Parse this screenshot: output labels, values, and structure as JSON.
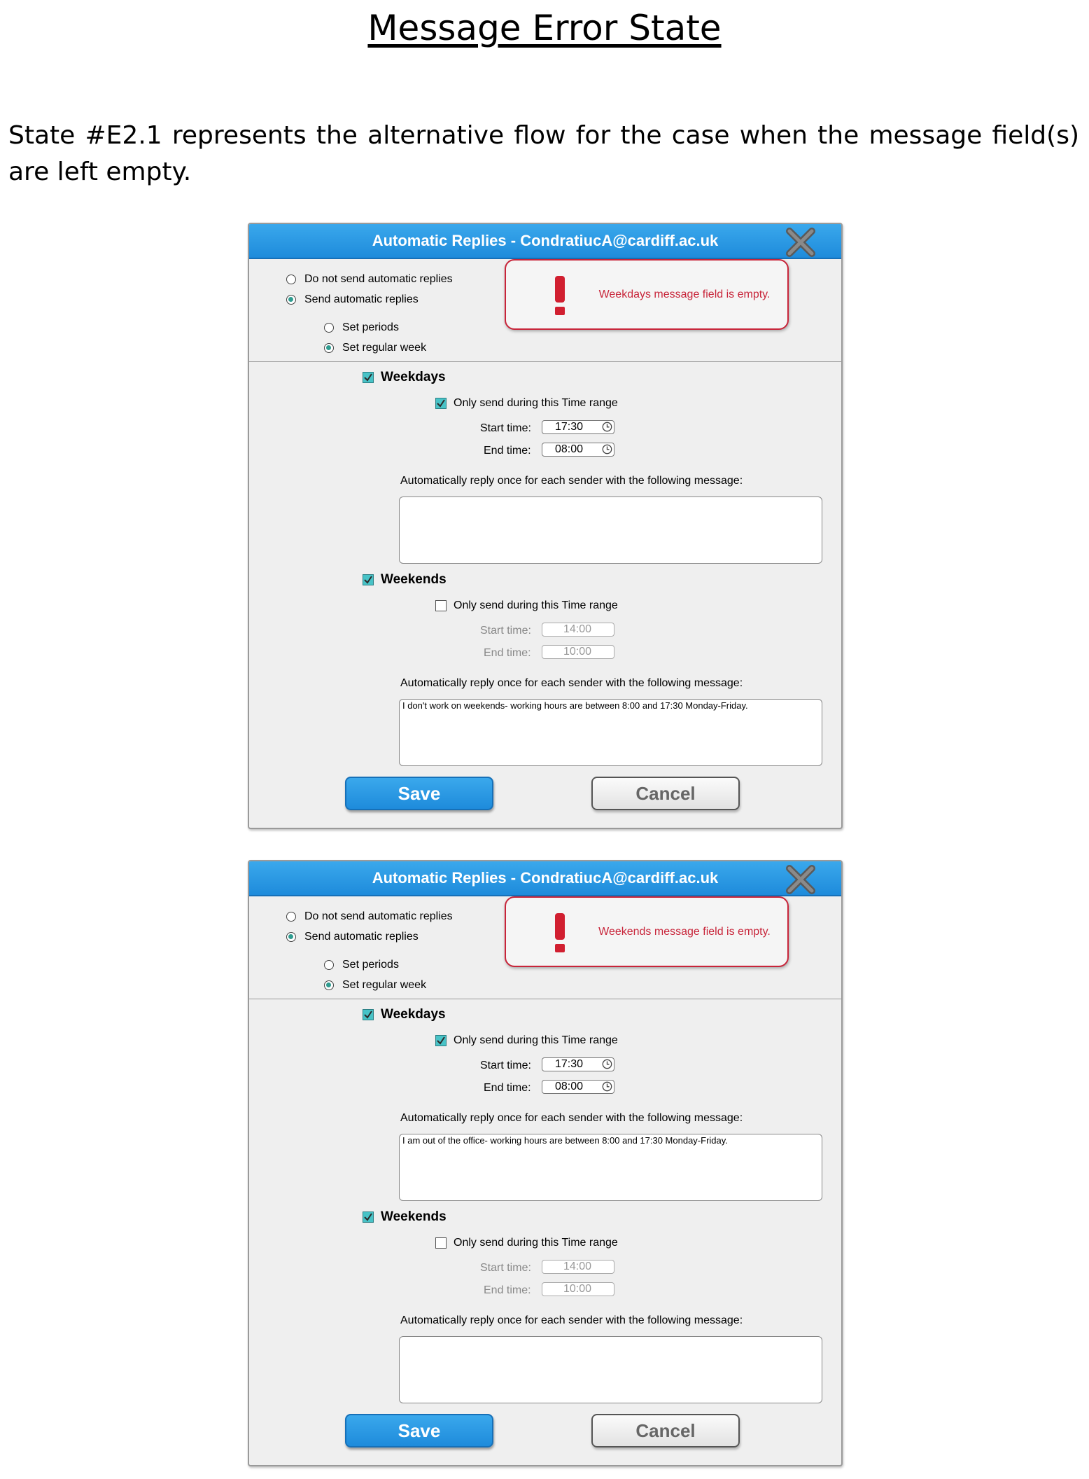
{
  "document": {
    "title": "Message Error State",
    "paragraph": "State #E2.1 represents the alternative flow for the case when the message field(s) are left empty."
  },
  "dialogs": [
    {
      "title": "Automatic Replies - CondratiucA@cardiff.ac.uk",
      "reply_mode": {
        "do_not_send": "Do not send automatic replies",
        "send": "Send automatic replies",
        "selected": "send"
      },
      "schedule_mode": {
        "set_periods": "Set periods",
        "set_regular_week": "Set regular week",
        "selected": "set_regular_week"
      },
      "error_message": "Weekdays message field is empty.",
      "weekdays": {
        "label": "Weekdays",
        "checked": true,
        "time_range_label": "Only send during this Time range",
        "time_range_checked": true,
        "start_label": "Start time:",
        "start_value": "17:30",
        "end_label": "End time:",
        "end_value": "08:00",
        "message_label": "Automatically reply once for each sender with the following message:",
        "message": ""
      },
      "weekends": {
        "label": "Weekends",
        "checked": true,
        "time_range_label": "Only send during this Time range",
        "time_range_checked": false,
        "start_label": "Start time:",
        "start_value": "14:00",
        "end_label": "End time:",
        "end_value": "10:00",
        "message_label": "Automatically reply once for each sender with the following message:",
        "message": "I don't work on weekends- working hours are between 8:00 and 17:30 Monday-Friday."
      },
      "save_label": "Save",
      "cancel_label": "Cancel"
    },
    {
      "title": "Automatic Replies - CondratiucA@cardiff.ac.uk",
      "reply_mode": {
        "do_not_send": "Do not send automatic replies",
        "send": "Send automatic replies",
        "selected": "send"
      },
      "schedule_mode": {
        "set_periods": "Set periods",
        "set_regular_week": "Set regular week",
        "selected": "set_regular_week"
      },
      "error_message": "Weekends message field is empty.",
      "weekdays": {
        "label": "Weekdays",
        "checked": true,
        "time_range_label": "Only send during this Time range",
        "time_range_checked": true,
        "start_label": "Start time:",
        "start_value": "17:30",
        "end_label": "End time:",
        "end_value": "08:00",
        "message_label": "Automatically reply once for each sender with the following message:",
        "message": "I am out of the office- working hours are between 8:00 and 17:30 Monday-Friday."
      },
      "weekends": {
        "label": "Weekends",
        "checked": true,
        "time_range_label": "Only send during this Time range",
        "time_range_checked": false,
        "start_label": "Start time:",
        "start_value": "14:00",
        "end_label": "End time:",
        "end_value": "10:00",
        "message_label": "Automatically reply once for each sender with the following message:",
        "message": ""
      },
      "save_label": "Save",
      "cancel_label": "Cancel"
    }
  ]
}
